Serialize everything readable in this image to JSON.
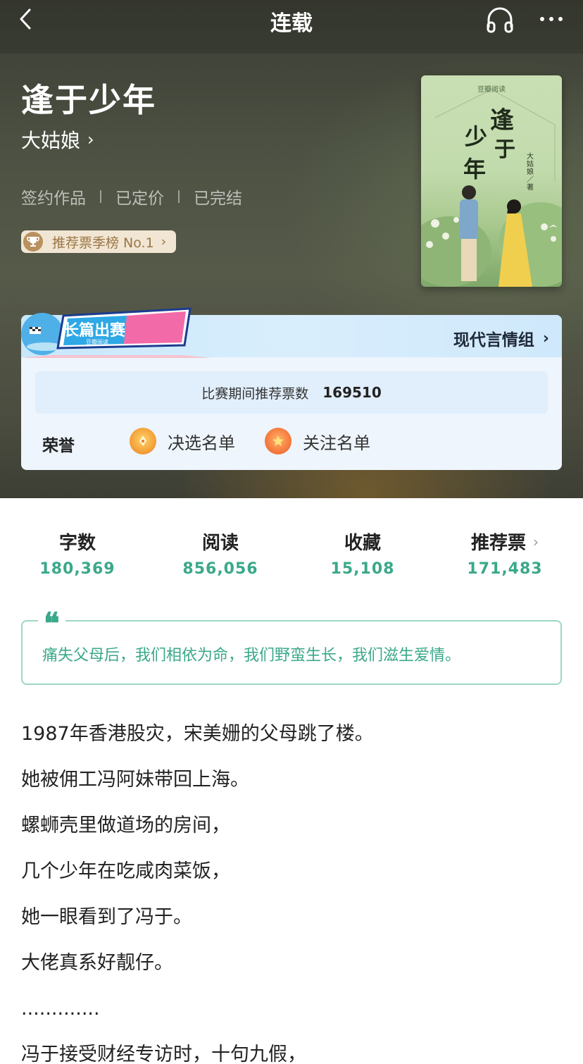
{
  "nav": {
    "title": "连载"
  },
  "book": {
    "title": "逢于少年",
    "author": "大姑娘",
    "tags": [
      "签约作品",
      "已定价",
      "已完结"
    ],
    "rank_badge": "推荐票季榜 No.1"
  },
  "cover": {
    "brand": "豆瓣阅读",
    "title_chars": [
      "逢",
      "于",
      "少",
      "年"
    ],
    "author_credit": "大姑娘／著"
  },
  "contest": {
    "logo_main": "长篇出赛",
    "logo_sub": "豆瓣阅读",
    "group": "现代言情组",
    "votes_label": "比赛期间推荐票数",
    "votes_value": "169510",
    "honor_label": "荣誉",
    "honors": [
      "决选名单",
      "关注名单"
    ]
  },
  "stats": [
    {
      "label": "字数",
      "value": "180,369"
    },
    {
      "label": "阅读",
      "value": "856,056"
    },
    {
      "label": "收藏",
      "value": "15,108"
    },
    {
      "label": "推荐票",
      "value": "171,483"
    }
  ],
  "quote": {
    "mark": "“",
    "text": "痛失父母后，我们相依为命，我们野蛮生长，我们滋生爱情。"
  },
  "synopsis": [
    "1987年香港股灾，宋美姗的父母跳了楼。",
    "她被佣工冯阿妹带回上海。",
    "螺蛳壳里做道场的房间，",
    "几个少年在吃咸肉菜饭，",
    "她一眼看到了冯于。",
    "大佬真系好靓仔。",
    ".............",
    "冯于接受财经专访时，十句九假，"
  ],
  "colors": {
    "accent": "#3aa88a",
    "quote_border": "#9dd7c3",
    "badge_bg": "#f1e6d3",
    "badge_text": "#9c7646",
    "contest_bg": "#eef5fd"
  },
  "icons": {
    "back": "back-arrow-icon",
    "listen": "headphones-icon",
    "more": "more-dots-icon",
    "trophy": "trophy-icon",
    "medal_finalist": "pen-medal-icon",
    "medal_watch": "star-medal-icon"
  }
}
